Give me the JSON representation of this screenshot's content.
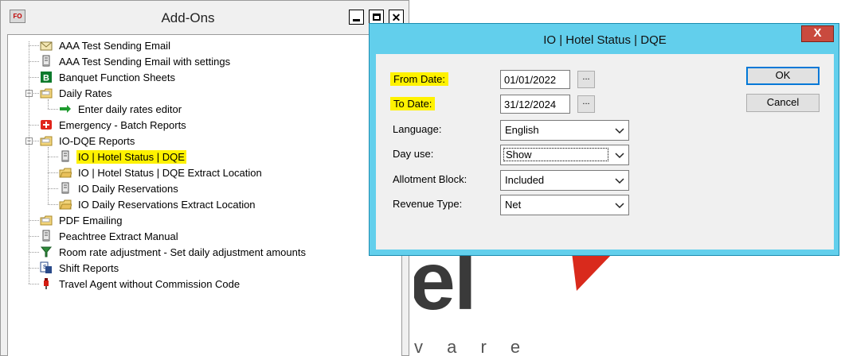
{
  "background": {
    "logo_letters": "el",
    "logo_tagline": "v a r e"
  },
  "addons": {
    "app_icon_text": "FO",
    "title": "Add-Ons",
    "tree": [
      {
        "label": "AAA Test Sending Email",
        "icon": "envelope-icon",
        "level": 1,
        "highlight": false
      },
      {
        "label": "AAA Test Sending Email with settings",
        "icon": "report-icon",
        "level": 1,
        "highlight": false
      },
      {
        "label": "Banquet Function Sheets",
        "icon": "b-badge-icon",
        "level": 1,
        "highlight": false
      },
      {
        "label": "Daily Rates",
        "icon": "folder-icon",
        "level": 1,
        "highlight": false,
        "expanded": true
      },
      {
        "label": "Enter daily rates editor",
        "icon": "green-arrow-icon",
        "level": 2,
        "highlight": false
      },
      {
        "label": "Emergency - Batch Reports",
        "icon": "red-cross-icon",
        "level": 1,
        "highlight": false
      },
      {
        "label": "IO-DQE Reports",
        "icon": "folder-icon",
        "level": 1,
        "highlight": false,
        "expanded": true
      },
      {
        "label": "IO | Hotel Status | DQE",
        "icon": "report-icon",
        "level": 2,
        "highlight": true
      },
      {
        "label": "IO | Hotel Status | DQE  Extract Location",
        "icon": "folder-open-icon",
        "level": 2,
        "highlight": false
      },
      {
        "label": "IO Daily Reservations",
        "icon": "report-icon",
        "level": 2,
        "highlight": false
      },
      {
        "label": "IO Daily Reservations  Extract Location",
        "icon": "folder-open-icon",
        "level": 2,
        "highlight": false
      },
      {
        "label": "PDF Emailing",
        "icon": "folder-icon",
        "level": 1,
        "highlight": false
      },
      {
        "label": "Peachtree Extract Manual",
        "icon": "report-icon",
        "level": 1,
        "highlight": false
      },
      {
        "label": "Room rate adjustment  -  Set daily adjustment amounts",
        "icon": "funnel-icon",
        "level": 1,
        "highlight": false
      },
      {
        "label": "Shift Reports",
        "icon": "shift-report-icon",
        "level": 1,
        "highlight": false
      },
      {
        "label": "Travel Agent without Commission Code",
        "icon": "red-pin-icon",
        "level": 1,
        "highlight": false
      }
    ]
  },
  "dialog": {
    "title": "IO | Hotel Status | DQE",
    "close_glyph": "X",
    "from_date_label": "From Date:",
    "from_date_value": "01/01/2022",
    "to_date_label": "To Date:",
    "to_date_value": "31/12/2024",
    "picker_label": "...",
    "language_label": "Language:",
    "language_value": "English",
    "day_use_label": "Day use:",
    "day_use_value": "Show",
    "allotment_label": "Allotment Block:",
    "allotment_value": "Included",
    "revenue_label": "Revenue Type:",
    "revenue_value": "Net",
    "ok_label": "OK",
    "cancel_label": "Cancel"
  },
  "colors": {
    "dialog_frame": "#62cfec",
    "highlight": "#fff200",
    "close_red": "#c94a3e"
  }
}
